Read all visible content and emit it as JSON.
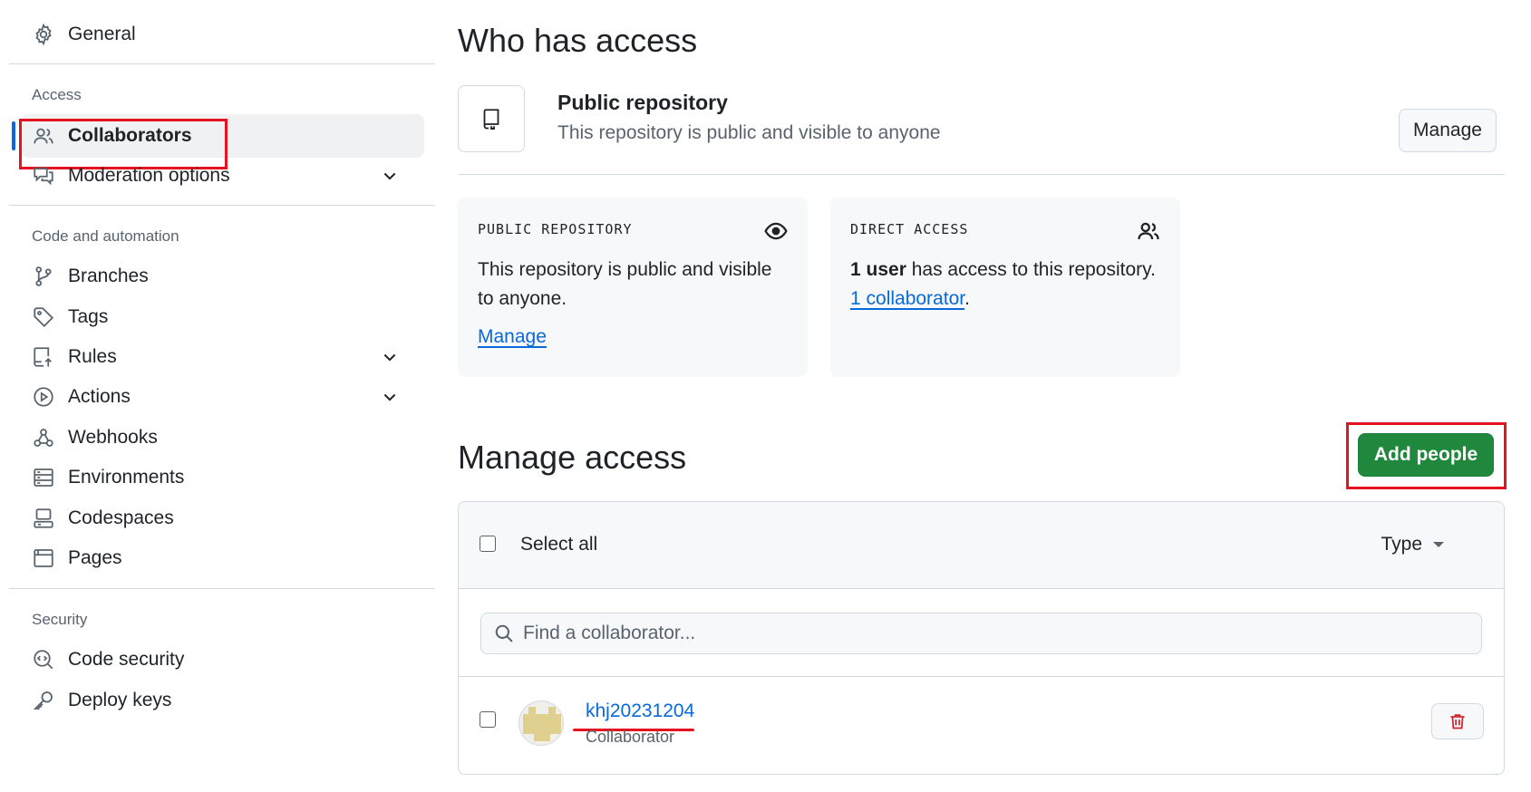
{
  "sidebar": {
    "general": "General",
    "access_title": "Access",
    "collaborators": "Collaborators",
    "moderation": "Moderation options",
    "code_title": "Code and automation",
    "branches": "Branches",
    "tags": "Tags",
    "rules": "Rules",
    "actions": "Actions",
    "webhooks": "Webhooks",
    "environments": "Environments",
    "codespaces": "Codespaces",
    "pages": "Pages",
    "security_title": "Security",
    "code_security": "Code security",
    "deploy_keys": "Deploy keys"
  },
  "who": {
    "title": "Who has access",
    "repo_title": "Public repository",
    "repo_sub": "This repository is public and visible to anyone",
    "manage_btn": "Manage"
  },
  "cards": {
    "public": {
      "label": "PUBLIC REPOSITORY",
      "text": "This repository is public and visible to anyone.",
      "link": "Manage"
    },
    "direct": {
      "label": "DIRECT ACCESS",
      "count": "1 user",
      "text": " has access to this repository.",
      "link": "1 collaborator",
      "suffix": "."
    }
  },
  "manage": {
    "title": "Manage access",
    "add_btn": "Add people",
    "select_all": "Select all",
    "type": "Type",
    "search_placeholder": "Find a collaborator...",
    "collaborators": [
      {
        "username": "khj20231204",
        "role": "Collaborator"
      }
    ]
  },
  "colors": {
    "accent": "#0969da",
    "primary_button": "#1f883d",
    "highlight": "#e5131f",
    "danger": "#d1242f"
  }
}
